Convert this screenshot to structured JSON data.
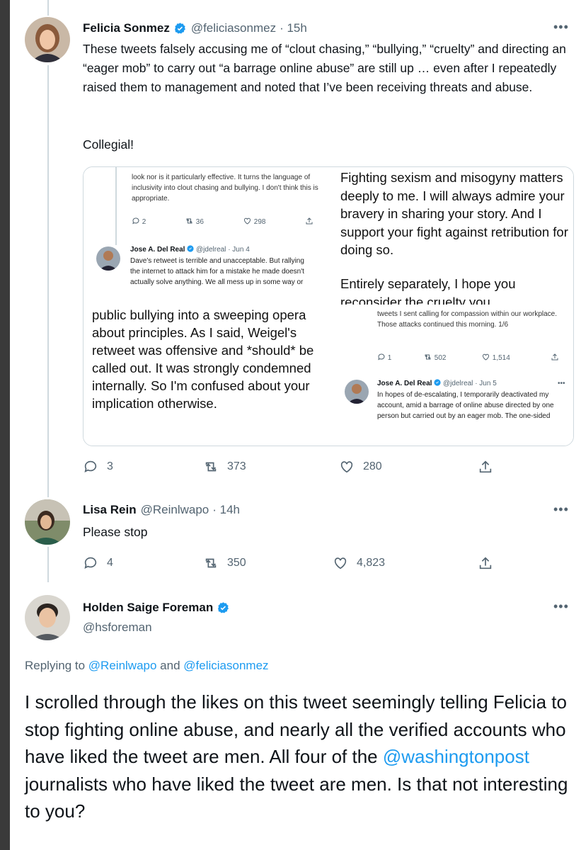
{
  "tweet1": {
    "name": "Felicia Sonmez",
    "handle": "@feliciasonmez",
    "time": "· 15h",
    "text_p1": "These tweets falsely accusing me of “clout chasing,” “bullying,” “cruelty” and directing an “eager mob” to carry out “a barrage online abuse” are still up … even after I repeatedly raised them to management and noted that I’ve been receiving threats and abuse.",
    "text_p2": "Collegial!",
    "more": "•••",
    "actions": {
      "replies": "3",
      "retweets": "373",
      "likes": "280"
    }
  },
  "quote": {
    "left_top": {
      "text": "look nor is it particularly effective. It turns the language of inclusivity into clout chasing and bullying. I don't think this is appropriate.",
      "replies": "2",
      "retweets": "36",
      "likes": "298"
    },
    "left_reply": {
      "name": "Jose A. Del Real",
      "handle": "@jdelreal",
      "time": "· Jun 4",
      "text": "Dave's retweet is terrible and unacceptable. But rallying the internet to attack him for a mistake he made doesn't actually solve anything. We all mess up in some way or"
    },
    "left_large": "public bullying into a sweeping opera about principles. As I said, Weigel's retweet was offensive and *should* be called out. It was strongly condemned internally. So I'm confused about your implication otherwise.",
    "right_large_1": "Fighting sexism and misogyny matters deeply to me. I will always admire your bravery in sharing your story.  And I support your fight against retribution for doing so.",
    "right_large_2": "Entirely separately, I hope you reconsider the cruelty you",
    "right_small": {
      "text": "tweets I sent calling for compassion within our workplace. Those attacks continued this morning. 1/6",
      "replies": "1",
      "retweets": "502",
      "likes": "1,514"
    },
    "right_reply": {
      "name": "Jose A. Del Real",
      "handle": "@jdelreal",
      "time": "· Jun 5",
      "more": "•••",
      "text": "In hopes of de-escalating, I temporarily deactivated my account, amid a barrage of online abuse directed by one person but carried out by an eager mob. The one-sided"
    }
  },
  "tweet2": {
    "name": "Lisa Rein",
    "handle": "@Reinlwapo",
    "time": "· 14h",
    "text": "Please stop",
    "more": "•••",
    "actions": {
      "replies": "4",
      "retweets": "350",
      "likes": "4,823"
    }
  },
  "tweet3": {
    "name": "Holden Saige Foreman",
    "handle": "@hsforeman",
    "more": "•••",
    "replying_prefix": "Replying to",
    "replying_user1": "@Reinlwapo",
    "replying_and": "and",
    "replying_user2": "@feliciasonmez",
    "text_a": "I scrolled through the likes on this tweet seemingly telling Felicia to stop fighting online abuse, and nearly all the verified accounts who have liked the tweet are men. All four of the",
    "text_mention": "@washingtonpost",
    "text_b": "journalists who have liked the tweet are men. Is that not interesting to you?"
  },
  "colors": {
    "accent": "#1d9bf0",
    "muted": "#536471",
    "border": "#cfd9de"
  },
  "icons": [
    "verified-badge-icon",
    "reply-icon",
    "retweet-icon",
    "like-icon",
    "share-icon",
    "more-icon"
  ]
}
